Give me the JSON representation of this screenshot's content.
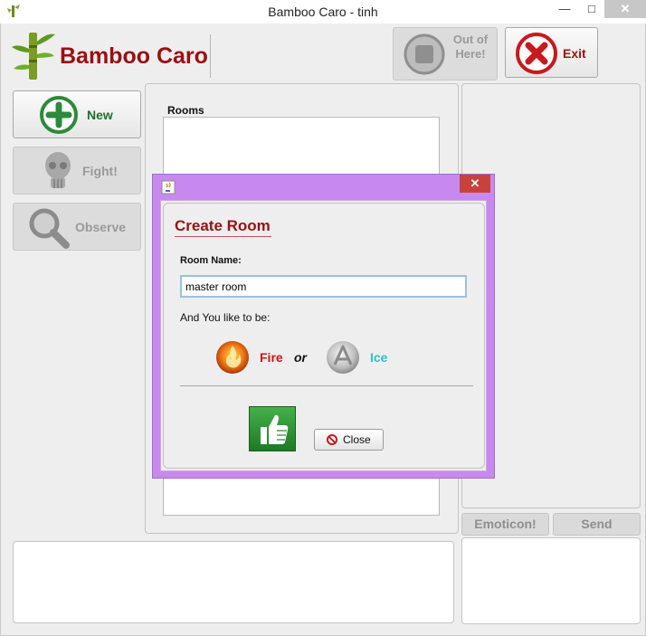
{
  "window": {
    "title": "Bamboo Caro - tinh",
    "icon": "bamboo-icon",
    "controls": {
      "minimize": "—",
      "maximize": "□",
      "close": "✕"
    }
  },
  "logo": {
    "text": "Bamboo Caro",
    "icon": "bamboo-icon",
    "color": "#9b0f12"
  },
  "toolbar": {
    "out_of_here": {
      "label": "Out of Here!",
      "icon": "stop-icon",
      "enabled": false
    },
    "exit": {
      "label": "Exit",
      "icon": "x-circle-icon",
      "enabled": true
    }
  },
  "side_actions": [
    {
      "label": "New",
      "icon": "plus-circle-icon",
      "enabled": true
    },
    {
      "label": "Fight!",
      "icon": "skull-icon",
      "enabled": false
    },
    {
      "label": "Observe",
      "icon": "magnifier-icon",
      "enabled": false
    }
  ],
  "rooms": {
    "label": "Rooms",
    "items": []
  },
  "chat": {
    "emoticon_label": "Emoticon!",
    "send_label": "Send"
  },
  "dialog": {
    "title": "Create Room",
    "room_name_label": "Room Name:",
    "room_name_value": "master room",
    "like_label": "And You like to be:",
    "fire_label": "Fire",
    "or_label": "or",
    "ice_label": "Ice",
    "ok_icon": "thumbs-up-icon",
    "close_label": "Close",
    "close_icon": "no-entry-icon",
    "frame_color": "#c889ef"
  }
}
